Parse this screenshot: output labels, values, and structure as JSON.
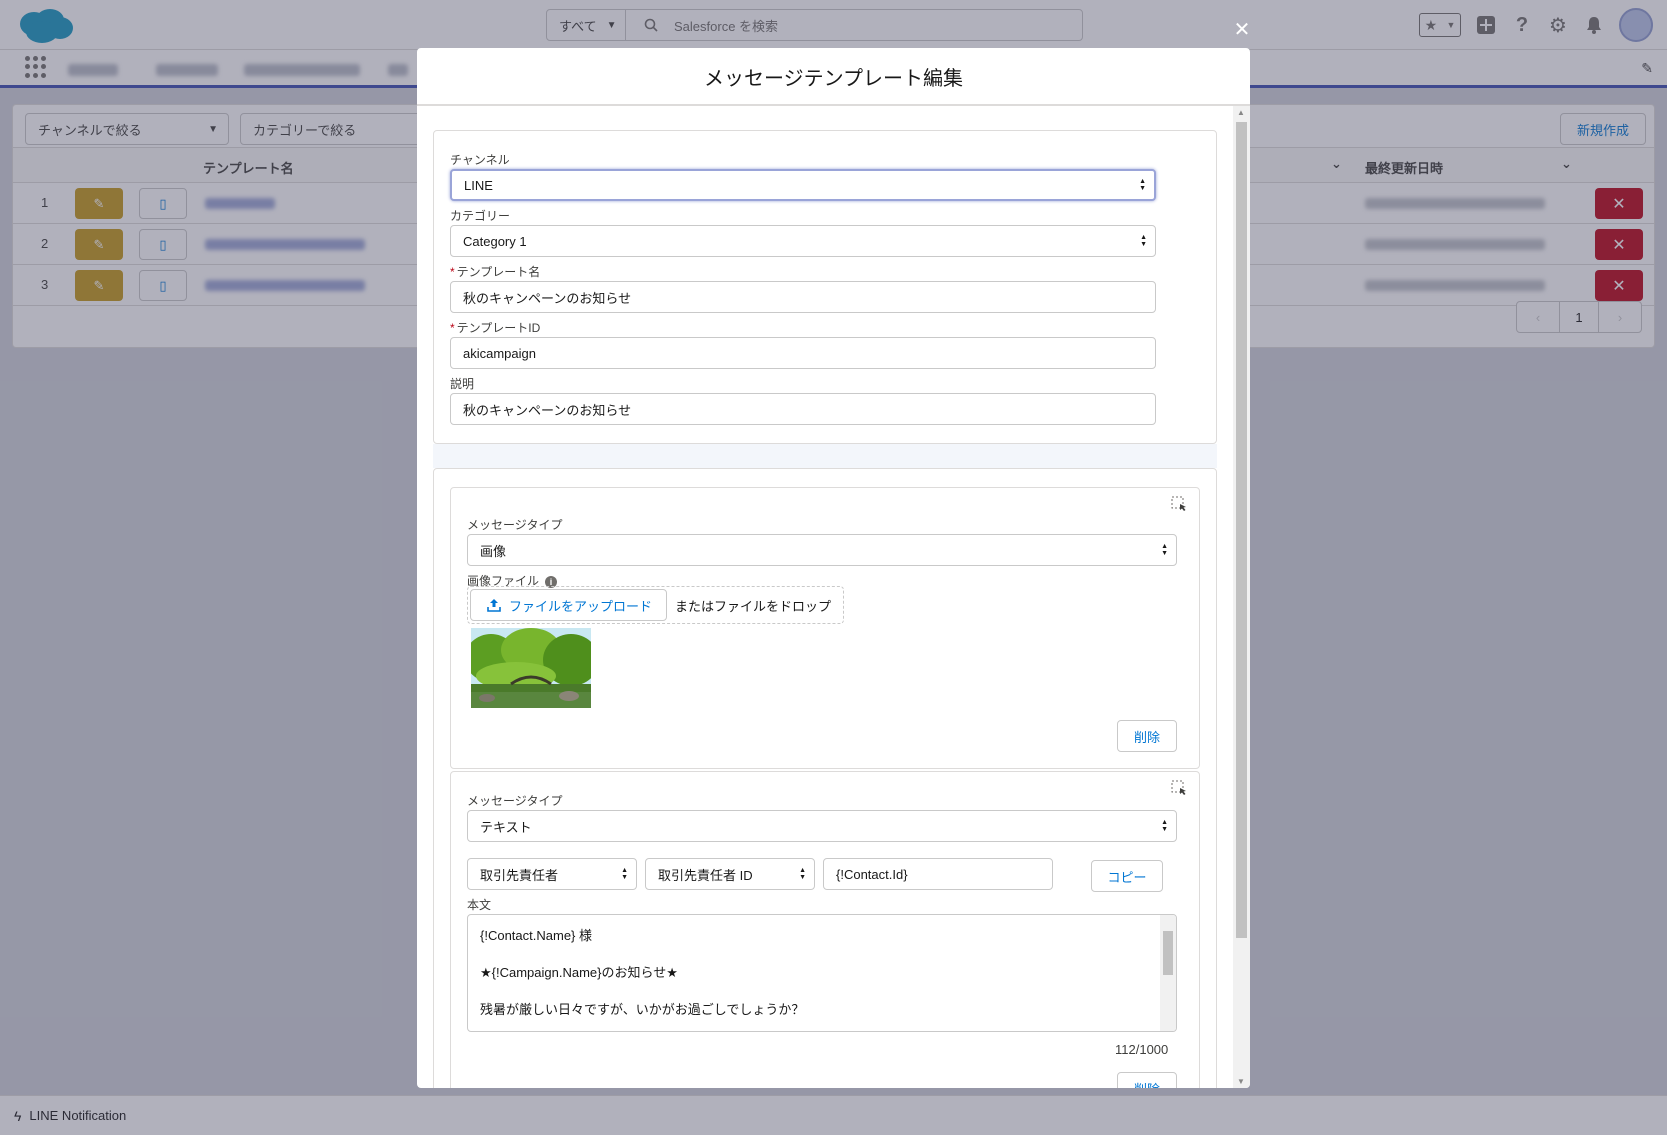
{
  "header": {
    "search_scope": "すべて",
    "search_placeholder": "Salesforce を検索"
  },
  "list": {
    "filter_channel": "チャンネルで絞る",
    "filter_category": "カテゴリーで絞る",
    "new_button": "新規作成",
    "col_name": "テンプレート名",
    "col_updated": "最終更新日時",
    "rows": [
      {
        "num": "1"
      },
      {
        "num": "2"
      },
      {
        "num": "3"
      }
    ],
    "page": "1"
  },
  "footer": {
    "utility_label": "LINE Notification"
  },
  "modal": {
    "title": "メッセージテンプレート編集",
    "channel_label": "チャンネル",
    "channel_value": "LINE",
    "category_label": "カテゴリー",
    "category_value": "Category 1",
    "template_name_label": "テンプレート名",
    "template_name_value": "秋のキャンペーンのお知らせ",
    "template_id_label": "テンプレートID",
    "template_id_value": "akicampaign",
    "description_label": "説明",
    "description_value": "秋のキャンペーンのお知らせ",
    "required_mark": "*",
    "blocks": [
      {
        "message_type_label": "メッセージタイプ",
        "message_type_value": "画像",
        "image_file_label": "画像ファイル",
        "upload_button": "ファイルをアップロード",
        "or_drop": "またはファイルをドロップ",
        "delete_button": "削除"
      },
      {
        "message_type_label": "メッセージタイプ",
        "message_type_value": "テキスト",
        "object_select": "取引先責任者",
        "field_select": "取引先責任者 ID",
        "merge_field": "{!Contact.Id}",
        "copy_button": "コピー",
        "body_label": "本文",
        "body_lines": [
          "{!Contact.Name} 様",
          "★{!Campaign.Name}のお知らせ★",
          "残暑が厳しい日々ですが、いかがお過ごしでしょうか？"
        ],
        "char_count": "112/1000",
        "delete_button": "削除"
      }
    ]
  },
  "colors": {
    "brand_blue": "#0176d3",
    "edit_yellow": "#c49a1a",
    "delete_red": "#ba0517"
  }
}
